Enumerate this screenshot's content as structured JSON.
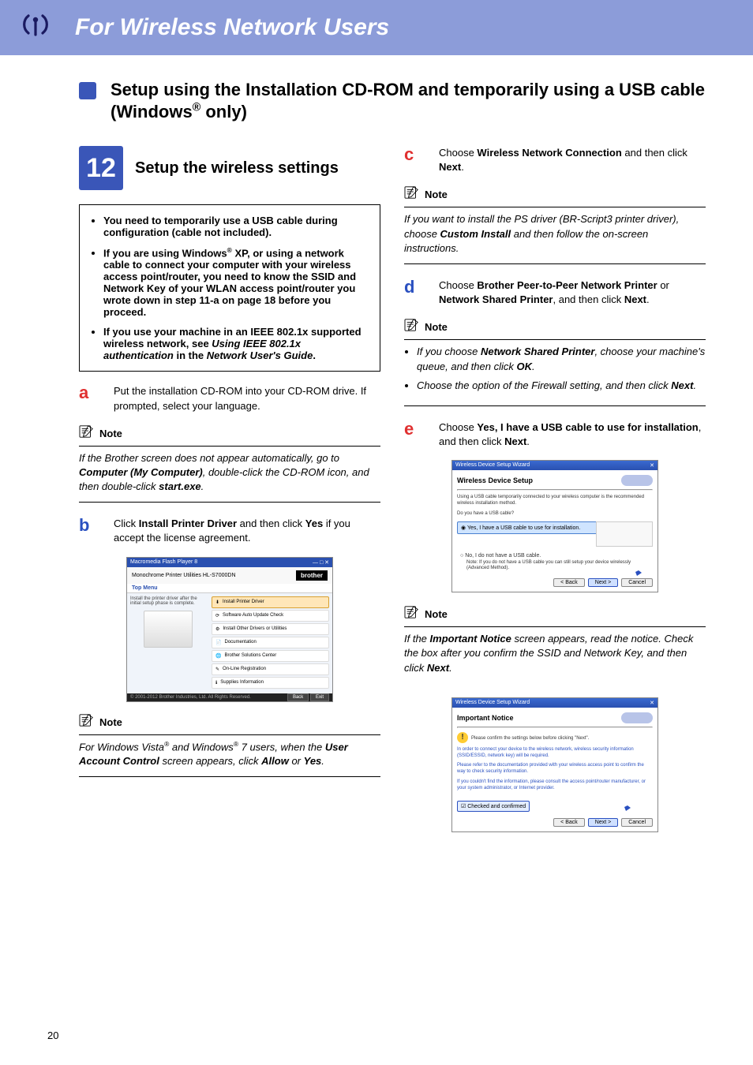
{
  "banner": {
    "title": "For Wireless Network Users"
  },
  "section": {
    "title_html": "Setup using the Installation CD-ROM and temporarily using a USB cable (Windows® only)"
  },
  "step12": {
    "number": "12",
    "title": "Setup the wireless settings",
    "bullets": [
      "You need to temporarily use a USB cable during configuration (cable not included).",
      "If you are using Windows® XP, or using a network cable to connect your computer with your wireless access point/router, you need to know the SSID and Network Key of your WLAN access point/router you wrote down in step 11-a on page 18 before you proceed.",
      "If you use your machine in an IEEE 802.1x supported wireless network, see Using IEEE 802.1x authentication in the Network User's Guide."
    ]
  },
  "steps": {
    "a": "Put the installation CD-ROM into your CD-ROM drive. If prompted, select your language.",
    "b": "Click Install Printer Driver and then click Yes if you accept the license agreement.",
    "c": "Choose Wireless Network Connection and then click Next.",
    "d": "Choose Brother Peer-to-Peer Network Printer or Network Shared Printer, and then click Next.",
    "e": "Choose Yes, I have a USB cable to use for installation, and then click Next."
  },
  "notes": {
    "label": "Note",
    "a": "If the Brother screen does not appear automatically, go to Computer (My Computer), double-click the CD-ROM icon, and then double-click start.exe.",
    "b": "For Windows Vista® and Windows® 7 users, when the User Account Control screen appears, click Allow or Yes.",
    "c": "If you want to install the PS driver (BR-Script3 printer driver), choose Custom Install and then follow the on-screen instructions.",
    "d_items": [
      "If you choose Network Shared Printer, choose your machine's queue, and then click OK.",
      "Choose the option of the Firewall setting, and then click Next."
    ],
    "e": "If the Important Notice screen appears, read the notice. Check the box after you confirm the SSID and Network Key, and then click Next."
  },
  "screenshot1": {
    "window_title": "Macromedia Flash Player 8",
    "brand": "brother",
    "product": "Monochrome Printer Utilities  HL-S7000DN",
    "top_menu": "Top Menu",
    "left_text": "Install the printer driver after the initial setup phase is complete.",
    "items": [
      "Install Printer Driver",
      "Software Auto Update Check",
      "Install Other Drivers or Utilities",
      "Documentation",
      "Brother Solutions Center",
      "On-Line Registration",
      "Supplies Information"
    ],
    "back": "Back",
    "exit": "Exit"
  },
  "screenshot2": {
    "window_title": "Wireless Device Setup Wizard",
    "heading": "Wireless Device Setup",
    "intro": "Using a USB cable temporarily connected to your wireless computer is the recommended wireless installation method.",
    "question": "Do you have a USB cable?",
    "opt_yes": "Yes, I have a USB cable to use for installation.",
    "opt_no": "No, I do not have a USB cable.",
    "opt_no_note": "Note: If you do not have a USB cable you can still setup your device wirelessly (Advanced Method).",
    "back": "< Back",
    "next": "Next >",
    "cancel": "Cancel"
  },
  "screenshot3": {
    "window_title": "Wireless Device Setup Wizard",
    "heading": "Important Notice",
    "line0": "Please confirm the settings below before clicking \"Next\".",
    "line1": "In order to connect your device to the wireless network, wireless security information (SSID/ESSID, network key) will be required.",
    "line2": "Please refer to the documentation provided with your wireless access point to confirm the way to check security information.",
    "line3": "If you couldn't find the information, please consult the access point/router manufacturer, or your system administrator, or Internet provider.",
    "check": "Checked and confirmed",
    "back": "< Back",
    "next": "Next >",
    "cancel": "Cancel"
  },
  "page_number": "20"
}
